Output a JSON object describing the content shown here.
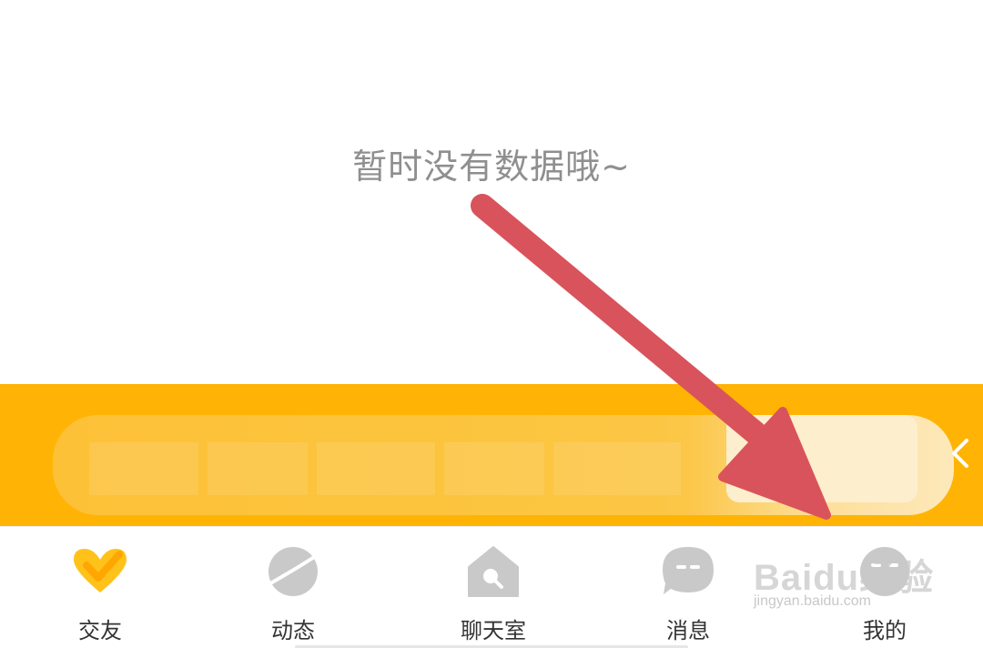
{
  "empty_state": {
    "message": "暂时没有数据哦~"
  },
  "banner": {
    "background_color": "#ffb405",
    "arrow_icon": "chevron-left-icon"
  },
  "tabs": [
    {
      "label": "交友",
      "icon": "heart-check-icon",
      "active": true,
      "color": "#ffb405"
    },
    {
      "label": "动态",
      "icon": "planet-icon",
      "active": false,
      "color": "#c9c9c9"
    },
    {
      "label": "聊天室",
      "icon": "house-icon",
      "active": false,
      "color": "#c9c9c9"
    },
    {
      "label": "消息",
      "icon": "chat-bubble-icon",
      "active": false,
      "color": "#c9c9c9"
    },
    {
      "label": "我的",
      "icon": "profile-icon",
      "active": false,
      "color": "#c9c9c9"
    }
  ],
  "annotation": {
    "arrow_color": "#d9535c",
    "arrow_icon": "pointer-arrow-icon"
  },
  "watermark": {
    "brand": "Baidu经验",
    "url": "jingyan.baidu.com"
  }
}
